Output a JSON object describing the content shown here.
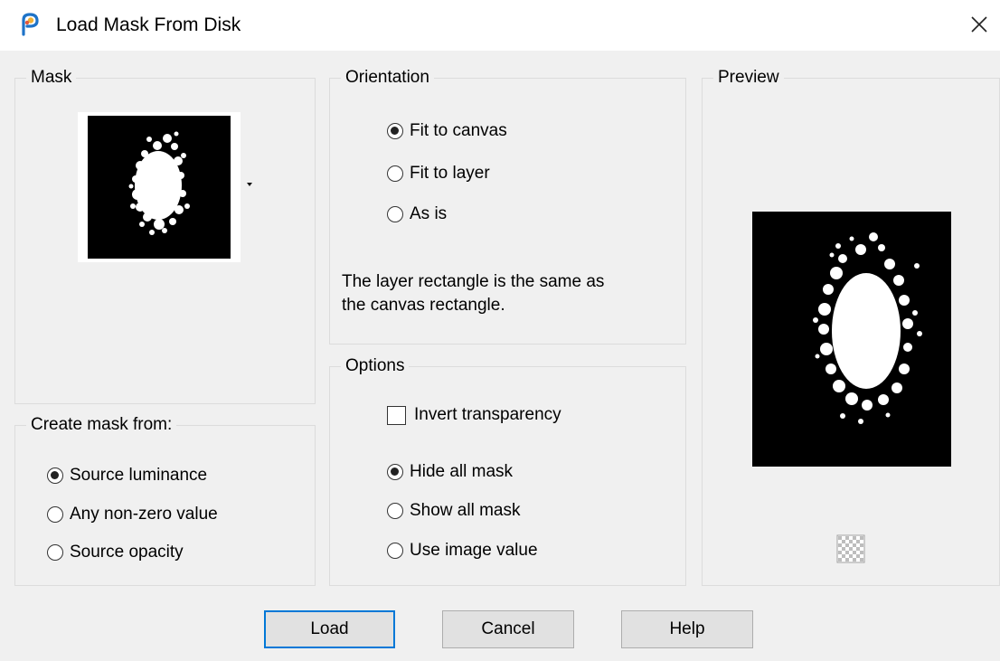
{
  "window": {
    "title": "Load Mask From Disk",
    "icon": "paint-brush-app-icon",
    "close_icon": "close-icon"
  },
  "mask": {
    "legend": "Mask",
    "thumbnail": "mask-thumbnail-image",
    "dropdown_icon": "triangle-down-icon"
  },
  "create_mask_from": {
    "legend": "Create mask from:",
    "options": [
      {
        "label": "Source luminance",
        "selected": true
      },
      {
        "label": "Any non-zero value",
        "selected": false
      },
      {
        "label": "Source opacity",
        "selected": false
      }
    ]
  },
  "orientation": {
    "legend": "Orientation",
    "options": [
      {
        "label": "Fit to canvas",
        "selected": true
      },
      {
        "label": "Fit to layer",
        "selected": false
      },
      {
        "label": "As is",
        "selected": false
      }
    ],
    "description_line1": "The layer rectangle is the same as",
    "description_line2": "the canvas rectangle."
  },
  "options": {
    "legend": "Options",
    "invert_transparency": {
      "label": "Invert transparency",
      "checked": false
    },
    "mask_display": [
      {
        "label": "Hide all mask",
        "selected": true
      },
      {
        "label": "Show all mask",
        "selected": false
      },
      {
        "label": "Use image value",
        "selected": false
      }
    ]
  },
  "preview": {
    "legend": "Preview",
    "image": "mask-preview-image",
    "toggle_icon": "checkerboard-icon"
  },
  "buttons": {
    "load": "Load",
    "cancel": "Cancel",
    "help": "Help"
  },
  "colors": {
    "accent": "#0078d7",
    "dialog_bg": "#f0f0f0"
  }
}
